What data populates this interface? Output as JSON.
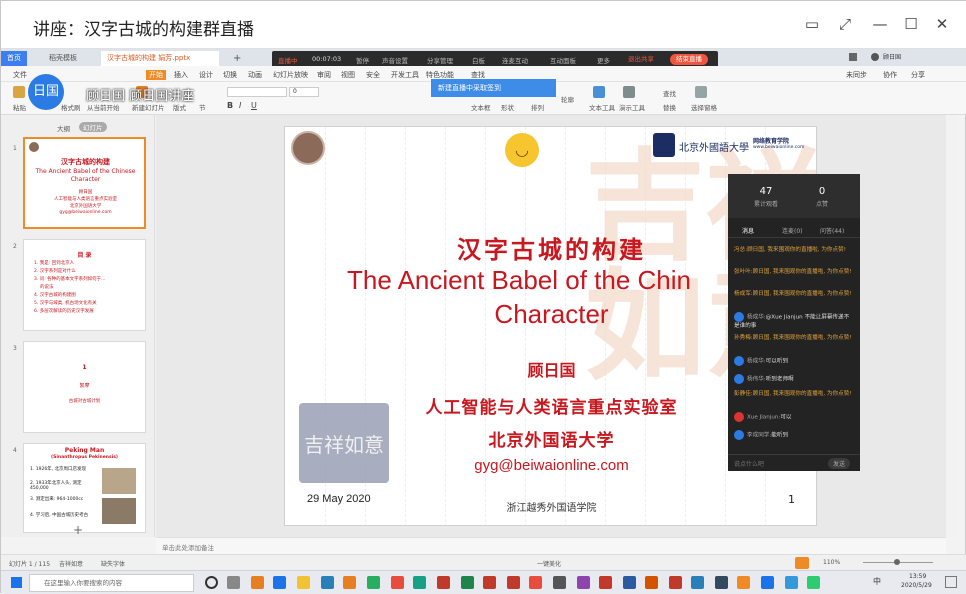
{
  "window": {
    "title": "讲座：汉字古城的构建群直播"
  },
  "browser_tabs": [
    {
      "label": "首页"
    },
    {
      "label": "稻壳模板"
    },
    {
      "label": "汉字古城的构建 娟芳.pptx"
    }
  ],
  "menu": [
    "文件",
    "开始",
    "插入",
    "设计",
    "切换",
    "动画",
    "幻灯片放映",
    "审阅",
    "视图",
    "安全",
    "开发工具",
    "特色功能",
    "查找"
  ],
  "ribbon": {
    "paste": "粘贴",
    "format_painter": "格式刷",
    "from_current": "从当前开始",
    "new_slide": "新建幻灯片",
    "layout": "版式",
    "section": "节",
    "textbox": "文本框",
    "shapes": "形状",
    "arrange": "排列",
    "outline": "轮廓",
    "text_tools": "文本工具",
    "slide_tools": "演示工具",
    "find": "查找",
    "replace": "替换",
    "select": "选择",
    "select_pane": "选择窗格",
    "font_size": "0"
  },
  "right_top": {
    "unsaved": "未同步",
    "collab": "协作",
    "share": "分享",
    "user": "顾日国"
  },
  "livebar": {
    "status": "直播中",
    "time": "00:07:03",
    "items": [
      "暂停",
      "声音设置",
      "分享管理",
      "白板",
      "连麦互动",
      "互动面板",
      "更多"
    ],
    "exit": "退出共享",
    "end": "结束直播"
  },
  "tip": "新建直播中采取签到",
  "presenter": {
    "avatar_text": "日国",
    "name": "顾日国 顾日国讲座"
  },
  "left_pane": {
    "tab_outline": "大纲",
    "tab_slides": "幻灯片"
  },
  "thumbnails": [
    {
      "num": "1",
      "lines": [
        "汉字古城的构建",
        "The Ancient Babel of the Chinese",
        "Character",
        "顾日国",
        "人工智能与人类语言重点实验室",
        "北京外国语大学",
        "gyg@beiwaionline.com"
      ]
    },
    {
      "num": "2",
      "lines": [
        "目 录",
        "1. 我是: 回到北京人",
        "2. 汉字系列是对什么",
        "3. 问: 各种的基本文字系列如何于...",
        "的说法",
        "4. 汉字古城的构建图",
        "5. 汉字与域类, 机古场文化有关",
        "6. 多层次解读的历史汉字发展"
      ]
    },
    {
      "num": "3",
      "lines": [
        "1",
        "絮摩",
        "古城对古城计划"
      ]
    },
    {
      "num": "4",
      "lines": [
        "Peking Man",
        "(Sinanthropus Pekinensis)",
        "1. 1926年, 北京周口店发现",
        "2. 1933年北京人头, 测定450,000",
        "3. 测定出来: 964-1000cc",
        "4. 学习后, 中国古城历史考古"
      ]
    }
  ],
  "slide": {
    "cn_title": "汉字古城的构建",
    "en_title_1": "The Ancient Babel of the Chin",
    "en_title_2": "Character",
    "author": "顾日国",
    "lab": "人工智能与人类语言重点实验室",
    "univ": "北京外国语大学",
    "email": "gyg@beiwaionline.com",
    "date": "29 May 2020",
    "page": "1",
    "school": "浙江越秀外国语学院",
    "logo_text": "北京外國語大學",
    "logo_sub": "网络教育学院",
    "logo_url": "www.beiwaionline.com",
    "bg_char": "吉祥如意",
    "stamp": "吉祥如意"
  },
  "chat": {
    "stats": [
      {
        "n": "47",
        "l": "累计观看"
      },
      {
        "n": "0",
        "l": "点赞"
      }
    ],
    "tabs": [
      "消息",
      "连麦(0)",
      "问答(44)"
    ],
    "messages": [
      {
        "who": "冯总:",
        "text": "顾日国, 我来围观你的直播啦, 为你点赞!",
        "style": "org"
      },
      {
        "who": "张叶叶:",
        "text": "顾日国, 我来围观你的直播啦, 为你点赞!",
        "style": "org"
      },
      {
        "who": "杨成军:",
        "text": "顾日国, 我来围观你的直播啦, 为你点赞!",
        "style": "org"
      },
      {
        "who": "杨成华:",
        "text": "@Xue Jianjun 不能让屏幕传递不是谁的事",
        "style": "blue"
      },
      {
        "who": "孙秀梅:",
        "text": "顾日国, 我来围观你的直播啦, 为你点赞!",
        "style": "org"
      },
      {
        "who": "杨成华:",
        "text": "可以听到",
        "style": "blue"
      },
      {
        "who": "杨伟华:",
        "text": "听到老师啊",
        "style": "blue"
      },
      {
        "who": "彭静佳:",
        "text": "顾日国, 我来围观你的直播啦, 为你点赞!",
        "style": "org"
      },
      {
        "who": "Xue Jianjun:",
        "text": "可以",
        "style": "blue"
      },
      {
        "who": "李成同学:",
        "text": "能听到",
        "style": "blue"
      }
    ],
    "input_placeholder": "说点什么吧",
    "send": "发送"
  },
  "notes_placeholder": "单击此处添加备注",
  "status": {
    "slide": "幻灯片 1 / 115",
    "theme": "吉祥如意",
    "missing_font": "缺失字体",
    "layout": "一键美化",
    "zoom": "110%"
  },
  "taskbar": {
    "search_placeholder": "在这里输入你要搜索的内容",
    "time": "13:59",
    "date": "2020/5/29",
    "ime": "中"
  },
  "colors": {
    "accent": "#c8171e",
    "live": "#f0553d",
    "taskbar": "#e9eaf0"
  }
}
